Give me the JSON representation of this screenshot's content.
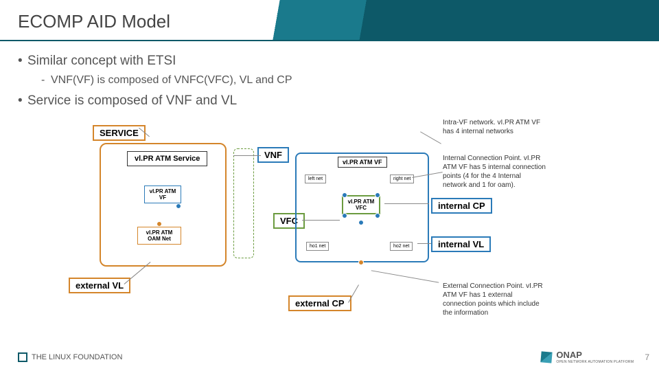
{
  "slide": {
    "title": "ECOMP AID Model",
    "page_number": "7"
  },
  "bullets": {
    "b1": "Similar concept with ETSI",
    "b1_sub1": "VNF(VF) is composed of VNFC(VFC), VL and CP",
    "b2": "Service is composed of VNF and VL"
  },
  "labels": {
    "service": "SERVICE",
    "vnf": "VNF",
    "vfc": "VFC",
    "external_vl": "external VL",
    "external_cp": "external CP",
    "internal_cp": "internal CP",
    "internal_vl": "internal VL"
  },
  "diagram": {
    "service_name": "vl.PR ATM Service",
    "vf_name": "vI.PR ATM VF",
    "oam_net": "vI.PR ATM OAM Net",
    "vf_title": "vI.PR ATM VF",
    "vfc_name": "vI.PR ATM VFC",
    "nets": {
      "left": "left net",
      "right": "right net",
      "ho1": "ho1 net",
      "ho2": "ho2 net"
    }
  },
  "notes": {
    "intra_vf": "Intra-VF network. vI.PR ATM VF has 4 internal networks",
    "int_cp": "Internal Connection Point. vI.PR ATM VF has 5 internal connection points (4 for the 4 Internal network and 1 for oam).",
    "ext_cp": "External Connection Point. vI.PR ATM VF has 1 external connection points which include the information"
  },
  "footer": {
    "linux_foundation": "THE LINUX FOUNDATION",
    "onap": "ONAP",
    "onap_sub": "OPEN NETWORK AUTOMATION PLATFORM"
  }
}
